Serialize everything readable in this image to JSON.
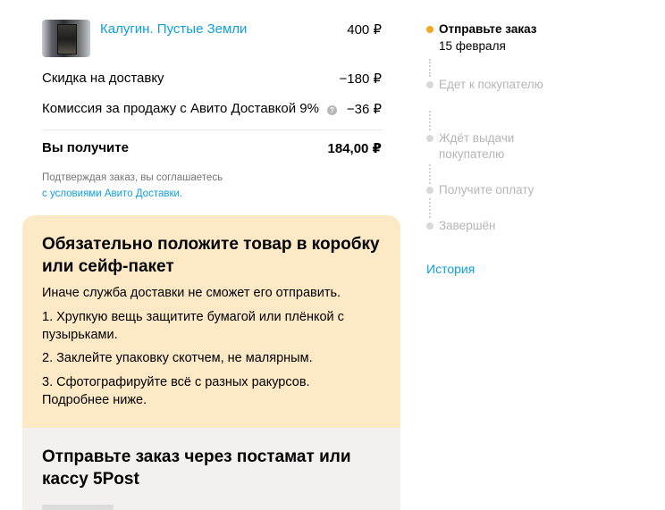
{
  "order": {
    "product_title": "Калугин. Пустые Земли",
    "product_price": "400 ₽",
    "discount_label": "Скидка на доставку",
    "discount_value": "−180 ₽",
    "commission_label": "Комиссия за продажу с Авито Доставкой 9%",
    "commission_value": "−36 ₽",
    "info_icon": "?",
    "total_label": "Вы получите",
    "total_value": "184,00 ₽",
    "note_text": "Подтверждая заказ, вы соглашаетесь",
    "note_link": "с условиями Авито Доставки."
  },
  "warning": {
    "title": "Обязательно положите товар в коробку или сейф-пакет",
    "intro": "Иначе служба доставки не сможет его отправить.",
    "item1": "1. Хрупкую вещь защитите бумагой или плёнкой с пузырьками.",
    "item2": "2. Заклейте упаковку скотчем, не малярным.",
    "item3": "3. Сфотографируйте всё с разных ракурсов. Подробнее ниже."
  },
  "shipping": {
    "title": "Отправьте заказ через постамат или кассу 5Post"
  },
  "steps": [
    {
      "label": "Отправьте заказ",
      "date": "15 февраля",
      "active": true
    },
    {
      "label": "Едет к покупателю",
      "active": false
    },
    {
      "label": "Ждёт выдачи покупателю",
      "active": false
    },
    {
      "label": "Получите оплату",
      "active": false
    },
    {
      "label": "Завершён",
      "active": false
    }
  ],
  "history_link": "История",
  "colors": {
    "link": "#0e9fe0",
    "accent": "#f5a623",
    "warning_bg": "#fde9c6",
    "section_bg": "#f2f1f0",
    "inactive": "#b5b5b5"
  }
}
